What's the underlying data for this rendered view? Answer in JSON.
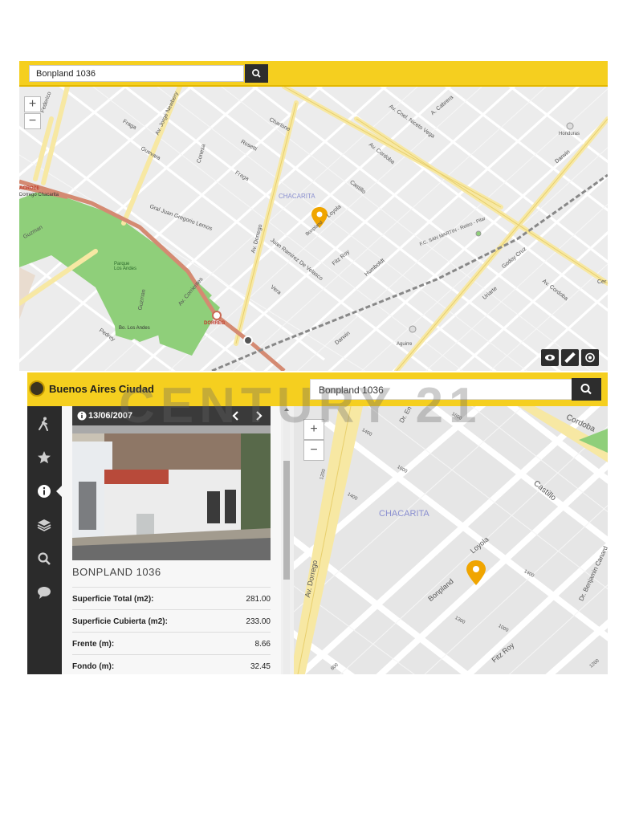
{
  "top_map": {
    "search_value": "Bonpland 1036",
    "zoom_in": "+",
    "zoom_out": "−",
    "tools": [
      "eye-icon",
      "ruler-icon",
      "locate-icon"
    ],
    "labels": {
      "federico": "Federico",
      "charlone": "Charlone",
      "rosetti": "Rosetti",
      "fraga1": "Fraga",
      "fraga2": "Fraga",
      "guevara": "Guevara",
      "newbery": "Av. Jorge Newbery",
      "conesa": "Conesa",
      "corrientes_heading": "Av. Corrientes",
      "chacarita": "CHACARITA",
      "crozet": "ACROZE",
      "chacarita_station": "Dorrego Chacarita",
      "lemos": "Gral Juan Gregorio Lemos",
      "guzman": "Guzman",
      "guzman2": "Guzman",
      "parque": "Parque\nLos Andes",
      "barrio": "Bo. Los Andes",
      "dorrego": "Av. Dorrego",
      "velasco": "Juan Ramirez De Velasco",
      "vera": "Vera",
      "castillo": "Castillo",
      "loyola": "Loyola",
      "bonpland": "Bonpland",
      "fitzroy": "Fitz Roy",
      "humboldt": "Humboldt",
      "darwin": "Darwin",
      "aguirre": "Aguirre",
      "cordoba": "Av. Cordoba",
      "cordoba2": "Av. Cordoba",
      "cnel_niceto": "Av. Cnel. Niceto Vega",
      "cabrera": "A. Cabrera",
      "godoy": "Godoy Cruz",
      "uriarte": "Uriarte",
      "honduras": "Honduras",
      "fc_sarmiento": "F.C. SAN MARTIN - Retiro - Pilar",
      "dorrego_st": "DORREG",
      "corrientes": "Av. Corrientes",
      "pedrey": "Pedrey",
      "ceres": "Cer",
      "darwin2": "Darwin"
    }
  },
  "app": {
    "brand": "Buenos Aires Ciudad",
    "search_value": "Bonpland 1036",
    "sidebar": [
      "walk-icon",
      "star-icon",
      "info-icon",
      "layers-icon",
      "search-icon",
      "chat-icon"
    ],
    "photo_date": "13/06/2007",
    "address_title": "BONPLAND 1036",
    "rows": [
      {
        "label": "Superficie Total (m2):",
        "value": "281.00"
      },
      {
        "label": "Superficie Cubierta (m2):",
        "value": "233.00"
      },
      {
        "label": "Frente (m):",
        "value": "8.66"
      },
      {
        "label": "Fondo (m):",
        "value": "32.45"
      }
    ],
    "map": {
      "zoom_in": "+",
      "zoom_out": "−",
      "labels": {
        "cordoba": "Cordoba",
        "castillo": "Castillo",
        "chacarita": "CHACARITA",
        "loyola": "Loyola",
        "bonpland": "Bonpland",
        "fitzroy": "Fitz Roy",
        "dorrego": "Av. Dorrego",
        "benjamin": "Dr. Benjamin Canard",
        "dr_en": "Dr. En",
        "n1600a": "1600",
        "n1400a": "1400",
        "n1200": "1200",
        "n1600b": "1600",
        "n1400b": "1400",
        "n1000": "1000",
        "n1400c": "1400",
        "n1300": "1300",
        "n800": "800",
        "n1200b": "1200"
      }
    }
  },
  "watermark": "CENTURY 21",
  "colors": {
    "brand_yellow": "#f5cf1f",
    "dark": "#2d2d2d",
    "marker": "#f0a500",
    "avenue": "#f7e8a3",
    "park": "#8fcf7a",
    "rail": "#d48a72"
  }
}
